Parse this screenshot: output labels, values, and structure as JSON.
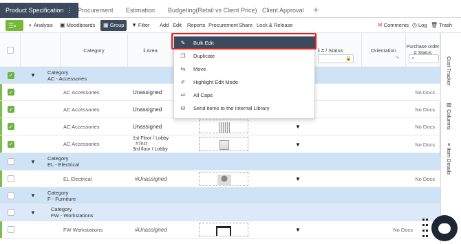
{
  "tabs": [
    {
      "label": "Product Specification",
      "active": true
    },
    {
      "label": "Procurement"
    },
    {
      "label": "Estimation"
    },
    {
      "label": "Budgeting(Retail vs Client Price)"
    },
    {
      "label": "Client Approval"
    }
  ],
  "toolbar": {
    "analysis": "Analysis",
    "moodboards": "Moodboards",
    "group": "Group",
    "filter": "Filter",
    "add": "Add",
    "edit": "Edit",
    "reports": "Reports",
    "procurement": "Procurement",
    "share": "Share",
    "lock_release": "Lock & Release",
    "comments": "Comments",
    "log": "Log",
    "trash": "Trash"
  },
  "headers": {
    "category": "Category",
    "area": "Area",
    "number_status": "# / Status",
    "orientation": "Orientation",
    "po_status": "Purchase order # Status"
  },
  "dropdown": {
    "items": [
      {
        "label": "Bulk Edit",
        "icon": "edit-icon",
        "glyph": "✎"
      },
      {
        "label": "Duplicate",
        "icon": "duplicate-icon",
        "glyph": "❐"
      },
      {
        "label": "Move",
        "icon": "move-icon",
        "glyph": "⇆"
      },
      {
        "label": "Highlight Edit Mode",
        "icon": "highlight-icon",
        "glyph": "✐"
      },
      {
        "label": "All Caps",
        "icon": "caps-icon",
        "glyph": "aA"
      },
      {
        "label": "Send items to the Internal Library",
        "icon": "library-icon",
        "glyph": "⛁"
      }
    ]
  },
  "rows": {
    "g1_title": "Category",
    "g1_sub": "AC - Accessories",
    "r1_cat": "AC Accessories",
    "r1_area": "Unassigned",
    "r1_po": "No Docs",
    "r2_cat": "AC Accessories",
    "r2_area": "Unassigned",
    "r2_po": "No Docs",
    "r3_cat": "AC Accessories",
    "r3_area": "Unassigned",
    "r3_po": "No Docs",
    "r4_cat": "AC Accessories",
    "r4_area1": "1st Floor / Lobby",
    "r4_area2": "#Test",
    "r4_area3": "3rd floor / Lobby",
    "r4_po": "No Docs",
    "g2_title": "Category",
    "g2_sub": "EL - Electrical",
    "r5_cat": "EL Electrical",
    "r5_area": "#Unassigned",
    "r5_po": "No Docs",
    "g3_title": "Category",
    "g3_sub": "F - Furniture",
    "g4_title": "Category",
    "g4_sub": "FW - Workstations",
    "r6_cat": "FW Workstations",
    "r6_area": "#Unassigned",
    "r6_po": "No Docs"
  },
  "side": {
    "cost_tracker": "Cost Tracker",
    "columns": "Columns",
    "item_details": "Item Details"
  },
  "colors": {
    "accent_dark": "#3c4a5e",
    "accent_green": "#6cb33f",
    "group_row": "#cfe3f6",
    "highlight": "#e32222"
  }
}
